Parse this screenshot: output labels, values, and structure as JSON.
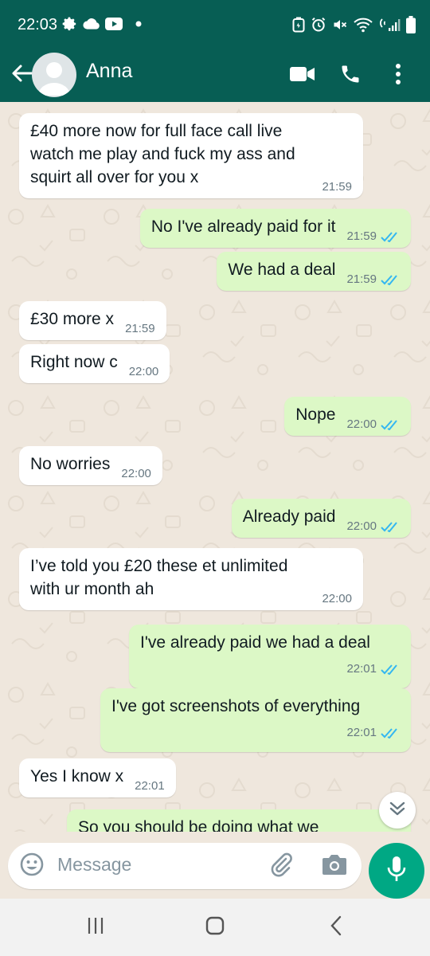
{
  "status_bar": {
    "time": "22:03",
    "left_icons": [
      "gear-icon",
      "cloud-icon",
      "youtube-icon",
      "dot-icon"
    ],
    "right_icons": [
      "battery-saver-icon",
      "alarm-icon",
      "mute-icon",
      "wifi-icon",
      "signal-icon",
      "battery-icon"
    ]
  },
  "header": {
    "contact_name": "Anna",
    "icons": [
      "back-arrow-icon",
      "video-call-icon",
      "voice-call-icon",
      "more-vert-icon"
    ]
  },
  "messages": [
    {
      "dir": "in",
      "text": "£40 more now for full face call live\nwatch me play and fuck my ass and\nsquirt all over for you x",
      "time": "21:59"
    },
    {
      "dir": "out",
      "text": "No I've already paid for it",
      "time": "21:59",
      "status": "read"
    },
    {
      "dir": "out",
      "text": "We had a deal",
      "time": "21:59",
      "status": "read"
    },
    {
      "dir": "in",
      "text": "£30 more x",
      "time": "21:59"
    },
    {
      "dir": "in",
      "text": "Right now c",
      "time": "22:00"
    },
    {
      "dir": "out",
      "text": "Nope",
      "time": "22:00",
      "status": "read"
    },
    {
      "dir": "in",
      "text": "No worries",
      "time": "22:00"
    },
    {
      "dir": "out",
      "text": "Already paid",
      "time": "22:00",
      "status": "read"
    },
    {
      "dir": "in",
      "text": "I’ve told you £20 these et unlimited\nwith ur month ah",
      "time": "22:00"
    },
    {
      "dir": "out",
      "text": "I've already paid we had a deal",
      "time": "22:01",
      "status": "read"
    },
    {
      "dir": "out",
      "text": "I've got screenshots of everything",
      "time": "22:01",
      "status": "read"
    },
    {
      "dir": "in",
      "text": "Yes I know x",
      "time": "22:01"
    },
    {
      "dir": "out",
      "text": "So you should be doing what we",
      "time": "",
      "status": "partial"
    }
  ],
  "composer": {
    "placeholder": "Message"
  },
  "colors": {
    "header_bg": "#075e54",
    "chat_bg": "#efe7dd",
    "outgoing_bubble": "#dcf8c6",
    "incoming_bubble": "#ffffff",
    "read_tick": "#34b7f1",
    "mic_button": "#00a884"
  }
}
